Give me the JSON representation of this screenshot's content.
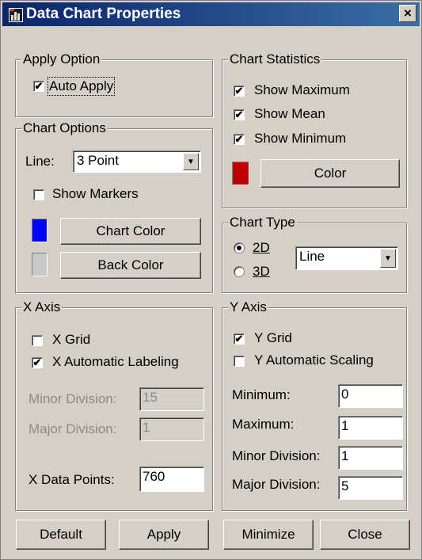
{
  "window": {
    "title": "Data Chart Properties",
    "close_glyph": "×"
  },
  "apply_option": {
    "legend": "Apply Option",
    "auto_apply": {
      "label": "Auto Apply",
      "checked": true
    }
  },
  "chart_options": {
    "legend": "Chart Options",
    "line_label": "Line:",
    "line_value": "3 Point",
    "show_markers": {
      "label": "Show Markers",
      "checked": false
    },
    "chart_color_label": "Chart Color",
    "chart_color": "#0000ff",
    "back_color_label": "Back Color",
    "back_color": "#c8c8c8"
  },
  "chart_statistics": {
    "legend": "Chart Statistics",
    "show_maximum": {
      "label": "Show Maximum",
      "checked": true
    },
    "show_mean": {
      "label": "Show Mean",
      "checked": true
    },
    "show_minimum": {
      "label": "Show Minimum",
      "checked": true
    },
    "color_label": "Color",
    "color": "#c00000"
  },
  "chart_type": {
    "legend": "Chart Type",
    "option_2d": {
      "label": "2D",
      "selected": true
    },
    "option_3d": {
      "label": "3D",
      "selected": false
    },
    "type_value": "Line"
  },
  "x_axis": {
    "legend": "X Axis",
    "x_grid": {
      "label": "X Grid",
      "checked": false
    },
    "x_auto_labeling": {
      "label": "X Automatic Labeling",
      "checked": true
    },
    "minor_division_label": "Minor Division:",
    "minor_division_value": "15",
    "major_division_label": "Major Division:",
    "major_division_value": "1",
    "data_points_label": "X Data Points:",
    "data_points_value": "760"
  },
  "y_axis": {
    "legend": "Y Axis",
    "y_grid": {
      "label": "Y Grid",
      "checked": true
    },
    "y_auto_scaling": {
      "label": "Y Automatic Scaling",
      "checked": false
    },
    "minimum_label": "Minimum:",
    "minimum_value": "0",
    "maximum_label": "Maximum:",
    "maximum_value": "1",
    "minor_division_label": "Minor Division:",
    "minor_division_value": "1",
    "major_division_label": "Major Division:",
    "major_division_value": "5"
  },
  "footer": {
    "default_label": "Default",
    "apply_label": "Apply",
    "minimize_label": "Minimize",
    "close_label": "Close"
  },
  "check_glyph": "✔",
  "icons": {
    "app": "chart-app-icon",
    "dropdown": "dropdown-arrow-icon",
    "close": "close-icon"
  }
}
